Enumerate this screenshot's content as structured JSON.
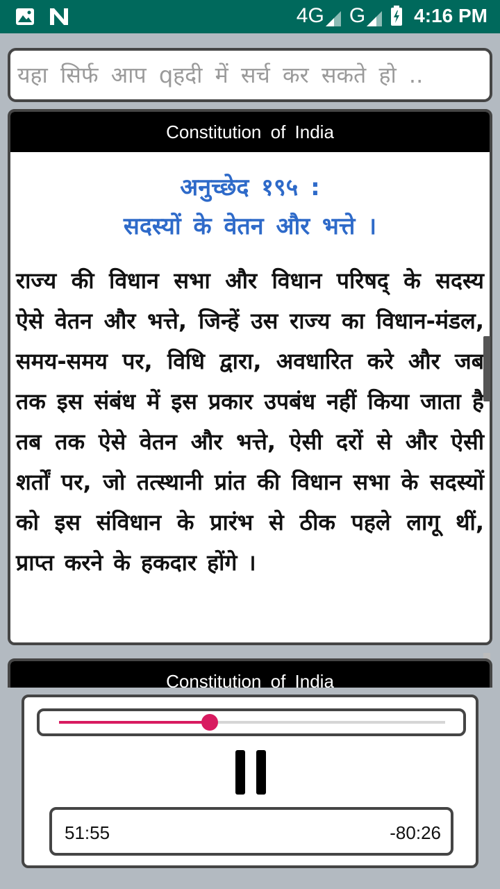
{
  "status_bar": {
    "left_icons": [
      "image-icon",
      "n-notification-icon"
    ],
    "network_1": "4G",
    "network_2": "G",
    "battery": "battery-charging-icon",
    "time": "4:16 PM"
  },
  "search": {
    "placeholder": "यहा सिर्फ आप qहदी में सर्च कर सकते हो .."
  },
  "cards": [
    {
      "header": "Constitution of India",
      "title": "अनुच्छेद १९५ :",
      "subtitle": "सदस्यों के वेतन और भत्ते ।",
      "body": "राज्य की विधान सभा और विधान परिषद् के सदस्य ऐसे वेतन और भत्ते, जिन्हें उस राज्य का विधान-मंडल, समय-समय पर, विधि द्वारा, अवधारित करे और जब तक इस संबंध में इस प्रकार उपबंध नहीं किया जाता है तब तक ऐसे वेतन और भत्ते, ऐसी दरों से और ऐसी शर्तों पर, जो तत्स्थानी प्रांत की विधान सभा के सदस्यों को इस संविधान के प्रारंभ से ठीक पहले लागू थीं, प्राप्त करने के हकदार होंगे ।"
    },
    {
      "header": "Constitution of India"
    }
  ],
  "player": {
    "progress": 0.39,
    "elapsed": "51:55",
    "remaining": "-80:26",
    "accent_color": "#d81b60",
    "pause_icon": "pause-icon"
  }
}
